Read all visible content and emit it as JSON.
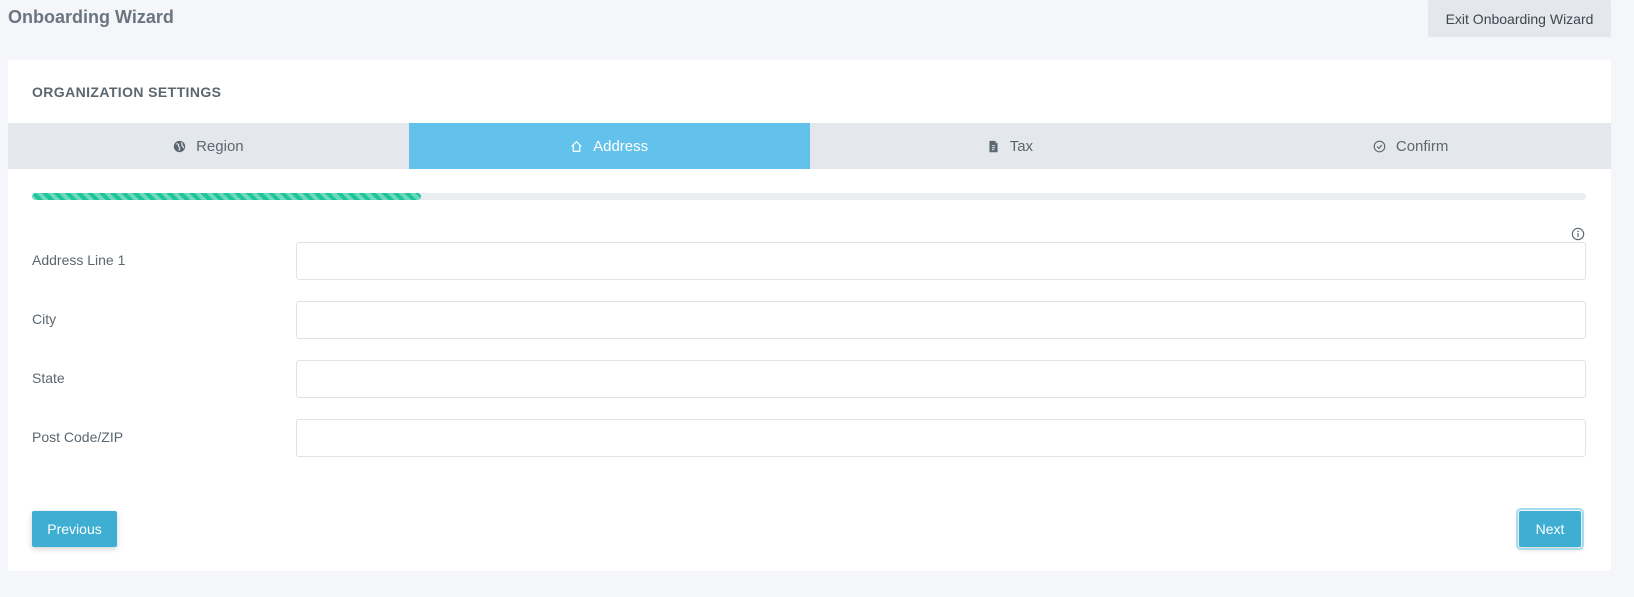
{
  "header": {
    "title": "Onboarding Wizard",
    "exit_label": "Exit Onboarding Wizard"
  },
  "section": {
    "title": "ORGANIZATION SETTINGS"
  },
  "tabs": [
    {
      "label": "Region",
      "icon": "globe-icon",
      "active": false
    },
    {
      "label": "Address",
      "icon": "home-icon",
      "active": true
    },
    {
      "label": "Tax",
      "icon": "document-icon",
      "active": false
    },
    {
      "label": "Confirm",
      "icon": "check-circle-icon",
      "active": false
    }
  ],
  "progress": {
    "percent": 25,
    "color": "#1fc59a"
  },
  "info_icon": "info-icon",
  "form": {
    "fields": [
      {
        "label": "Address Line 1",
        "value": "",
        "placeholder": ""
      },
      {
        "label": "City",
        "value": "",
        "placeholder": ""
      },
      {
        "label": "State",
        "value": "",
        "placeholder": ""
      },
      {
        "label": "Post Code/ZIP",
        "value": "",
        "placeholder": ""
      }
    ]
  },
  "buttons": {
    "previous_label": "Previous",
    "next_label": "Next"
  },
  "colors": {
    "accent": "#3eaed3",
    "active_tab": "#63c2ec",
    "tab_bar": "#e4e8ec",
    "progress": "#1fc59a"
  }
}
